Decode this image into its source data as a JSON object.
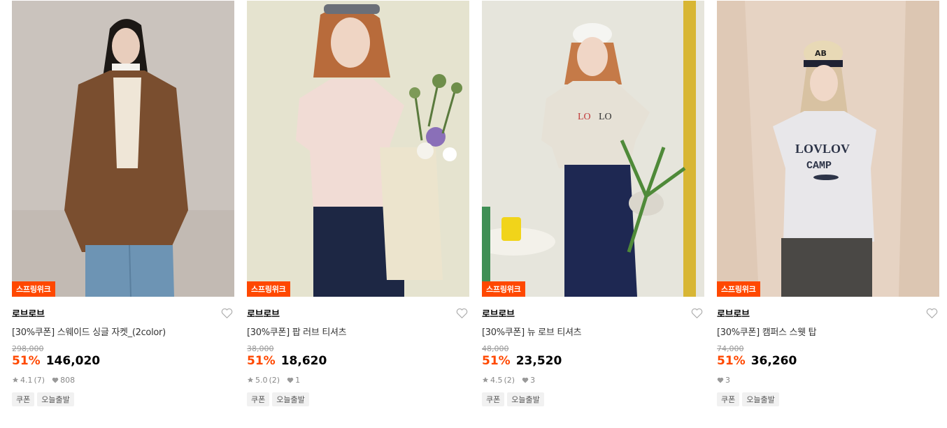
{
  "products": [
    {
      "badge": "스프링위크",
      "brand": "로브로브",
      "title": "[30%쿠폰] 스웨이드 싱글 자켓_(2color)",
      "original_price": "298,000",
      "discount_rate": "51%",
      "price": "146,020",
      "rating": "4.1",
      "review_count": "(7)",
      "likes": "808",
      "tags": [
        "쿠폰",
        "오늘출발"
      ],
      "image_alt": "model in brown suede jacket and blue jeans"
    },
    {
      "badge": "스프링위크",
      "brand": "로브로브",
      "title": "[30%쿠폰] 팝 러브 티셔츠",
      "original_price": "38,000",
      "discount_rate": "51%",
      "price": "18,620",
      "rating": "5.0",
      "review_count": "(2)",
      "likes": "1",
      "tags": [
        "쿠폰",
        "오늘출발"
      ],
      "image_alt": "model in pink t-shirt with tote bag of flowers"
    },
    {
      "badge": "스프링위크",
      "brand": "로브로브",
      "title": "[30%쿠폰] 뉴 로브 티셔츠",
      "original_price": "48,000",
      "discount_rate": "51%",
      "price": "23,520",
      "rating": "4.5",
      "review_count": "(2)",
      "likes": "3",
      "tags": [
        "쿠폰",
        "오늘출발"
      ],
      "image_alt": "model in grey LOLO t-shirt and navy pants holding a plant"
    },
    {
      "badge": "스프링위크",
      "brand": "로브로브",
      "title": "[30%쿠폰] 캠퍼스 스웻 탑",
      "original_price": "74,000",
      "discount_rate": "51%",
      "price": "36,260",
      "rating": "",
      "review_count": "",
      "likes": "3",
      "tags": [
        "쿠폰",
        "오늘출발"
      ],
      "image_alt": "model in grey LOVLOV CAMP sleeveless sweat top and cap"
    }
  ],
  "colors": {
    "accent": "#ff4800",
    "price": "#000000",
    "muted": "#999999",
    "tag_bg": "#f1f1f1"
  },
  "icons": {
    "wishlist": "heart-outline-icon",
    "rating": "star-icon",
    "likes": "heart-filled-icon"
  }
}
